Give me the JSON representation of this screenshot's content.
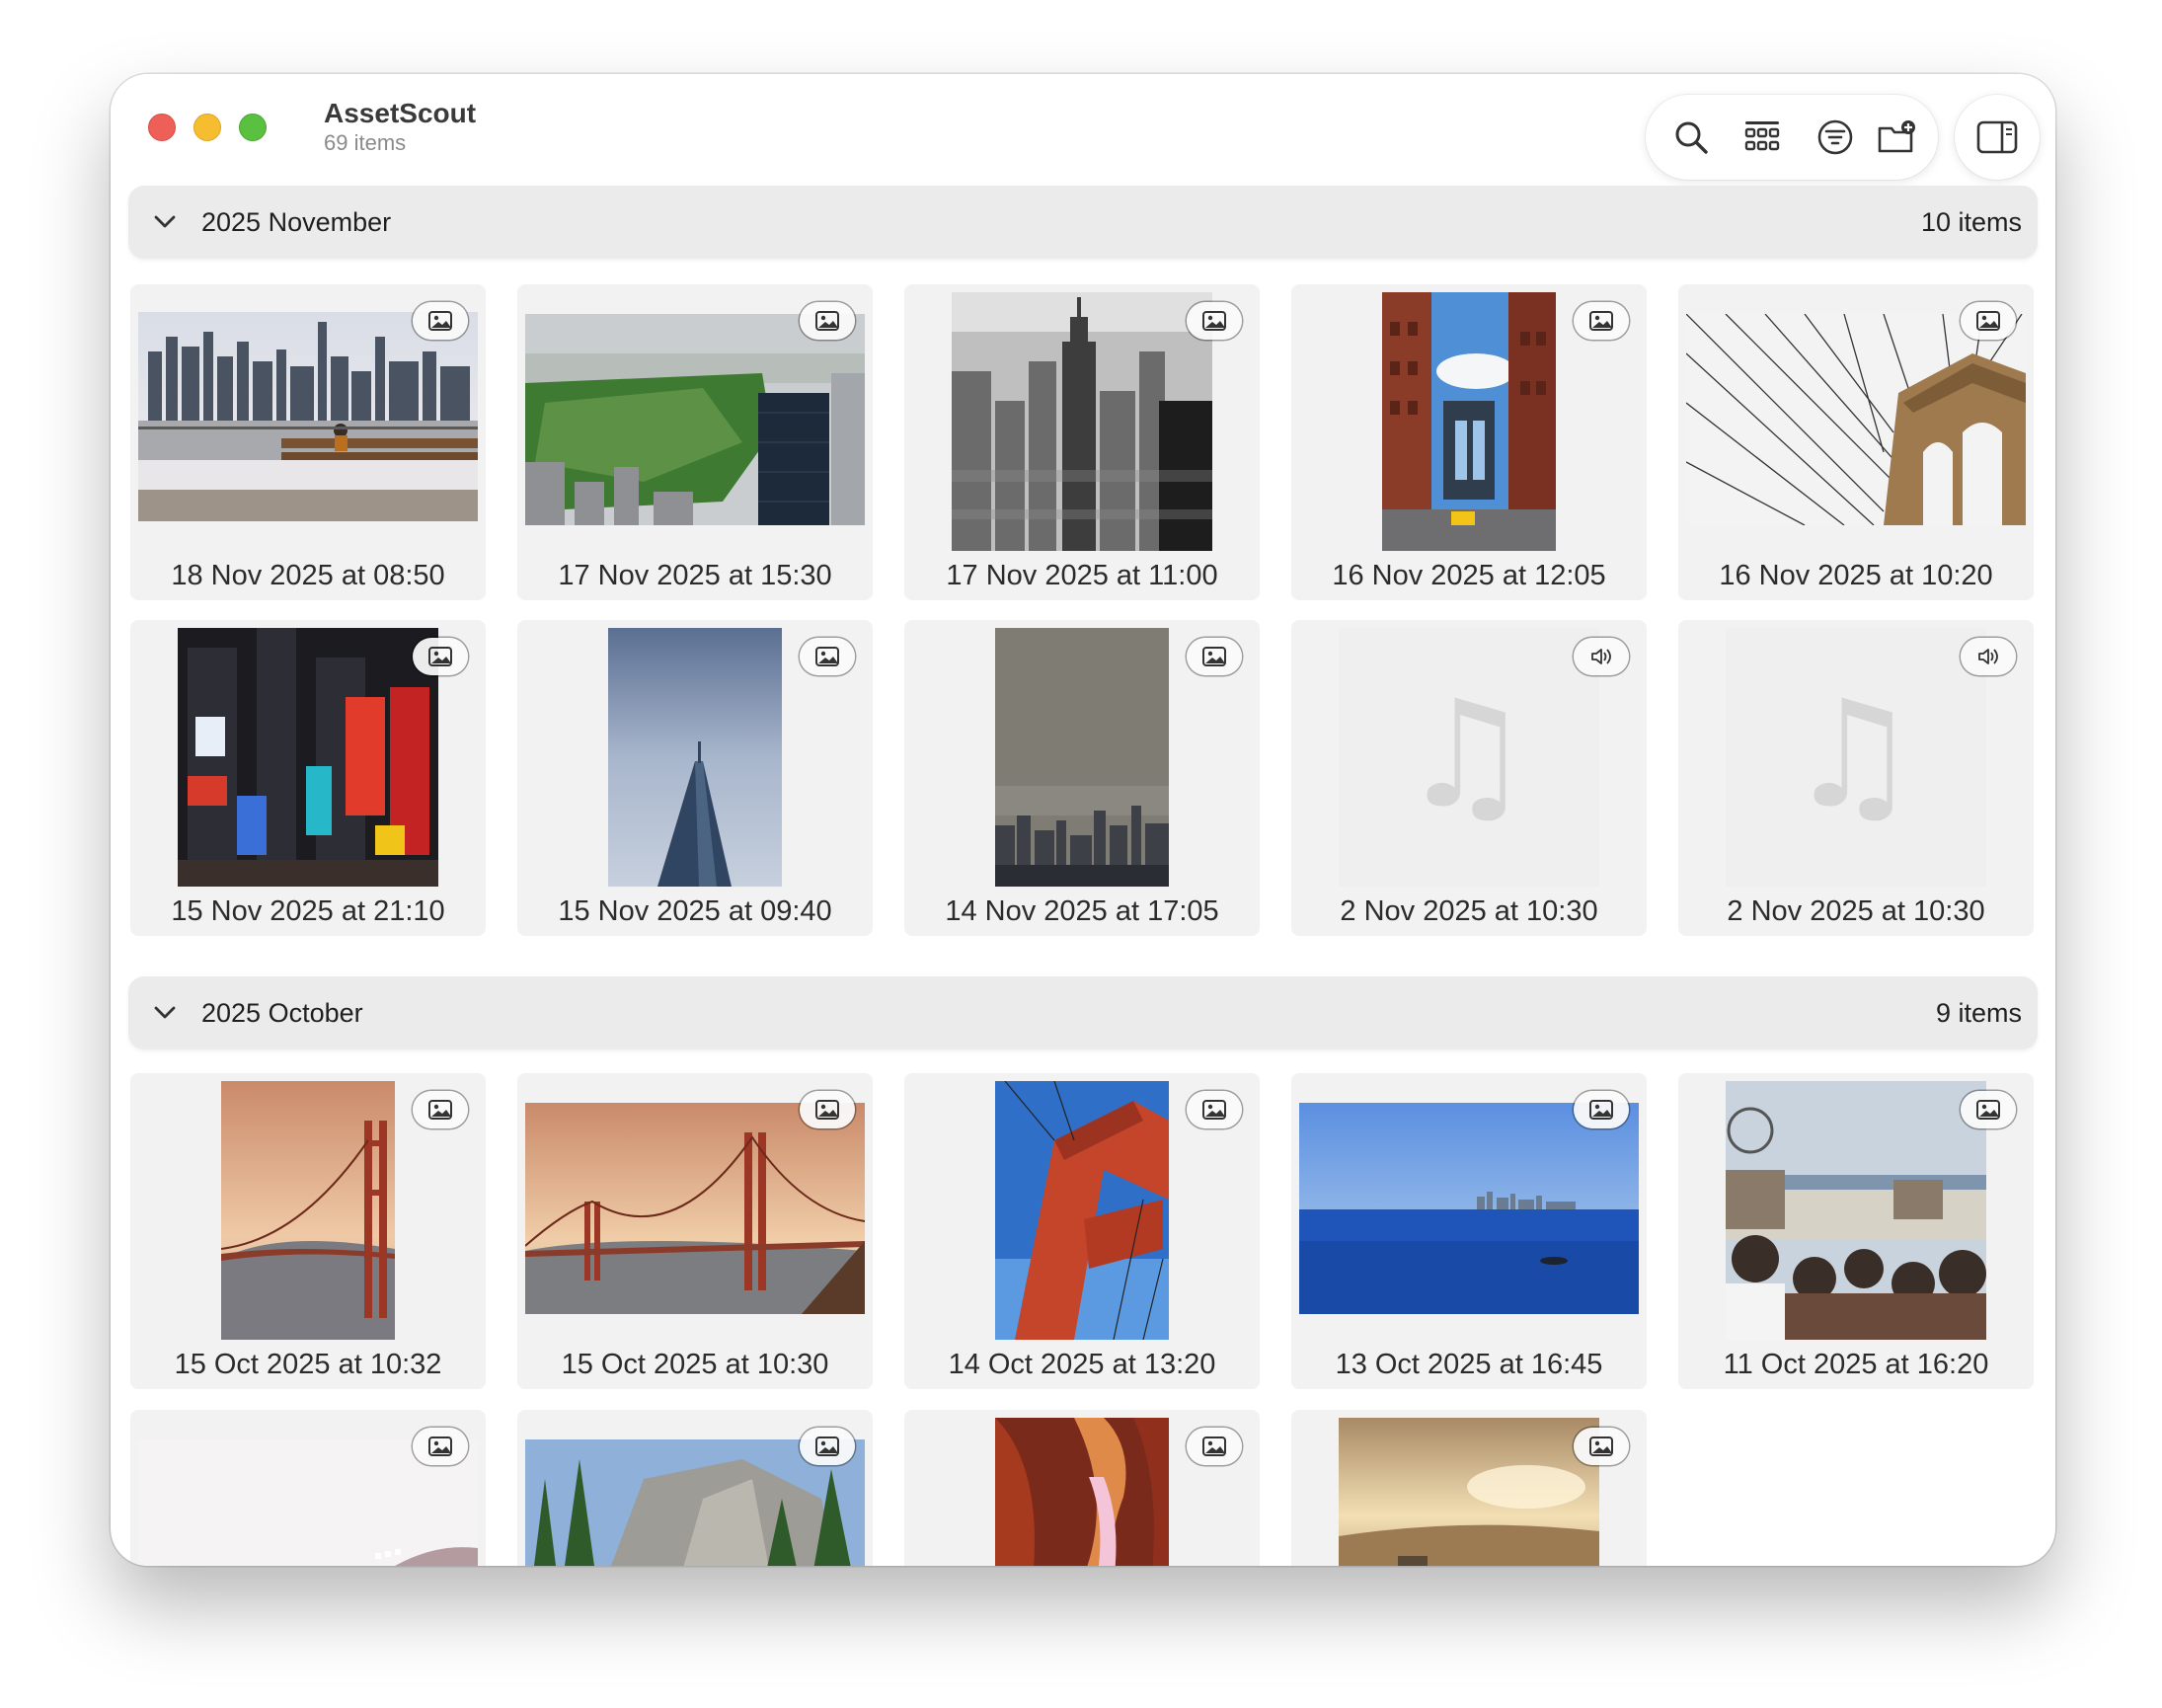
{
  "window": {
    "title": "AssetScout",
    "subtitle": "69 items"
  },
  "toolbar": {
    "icons": [
      "search-icon",
      "grid-view-icon",
      "filter-icon",
      "new-folder-icon"
    ],
    "sidebar_icon": "sidebar-toggle-icon"
  },
  "sections": [
    {
      "title": "2025 November",
      "count": "10 items",
      "items": [
        {
          "caption": "18 Nov 2025 at 08:50",
          "kind": "image"
        },
        {
          "caption": "17 Nov 2025 at 15:30",
          "kind": "image"
        },
        {
          "caption": "17 Nov 2025 at 11:00",
          "kind": "image"
        },
        {
          "caption": "16 Nov 2025 at 12:05",
          "kind": "image"
        },
        {
          "caption": "16 Nov 2025 at 10:20",
          "kind": "image"
        },
        {
          "caption": "15 Nov 2025 at 21:10",
          "kind": "image"
        },
        {
          "caption": "15 Nov 2025 at 09:40",
          "kind": "image"
        },
        {
          "caption": "14 Nov 2025 at 17:05",
          "kind": "image"
        },
        {
          "caption": "2 Nov 2025 at 10:30",
          "kind": "audio"
        },
        {
          "caption": "2 Nov 2025 at 10:30",
          "kind": "audio"
        }
      ]
    },
    {
      "title": "2025 October",
      "count": "9 items",
      "items": [
        {
          "caption": "15 Oct 2025 at 10:32",
          "kind": "image"
        },
        {
          "caption": "15 Oct 2025 at 10:30",
          "kind": "image"
        },
        {
          "caption": "14 Oct 2025 at 13:20",
          "kind": "image"
        },
        {
          "caption": "13 Oct 2025 at 16:45",
          "kind": "image"
        },
        {
          "caption": "11 Oct 2025 at 16:20",
          "kind": "image"
        },
        {
          "caption": "",
          "kind": "image"
        },
        {
          "caption": "",
          "kind": "image"
        },
        {
          "caption": "",
          "kind": "image"
        },
        {
          "caption": "",
          "kind": "image"
        }
      ]
    }
  ]
}
